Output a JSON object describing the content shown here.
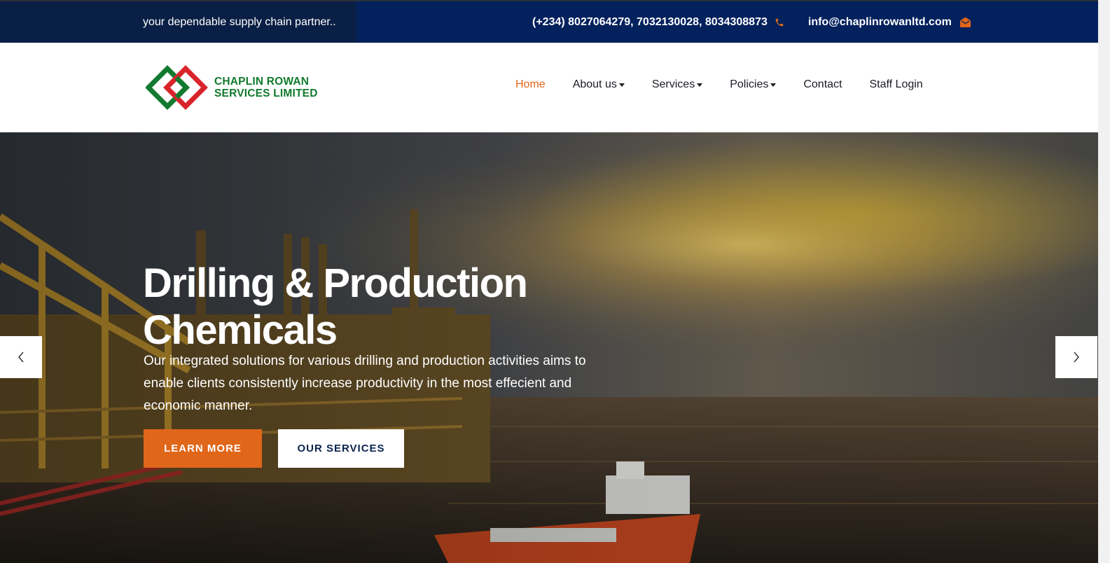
{
  "topbar": {
    "tagline": "your dependable supply chain partner..",
    "phone": "(+234) 8027064279, 7032130028, 8034308873",
    "phone_icon": "phone-icon",
    "email": "info@chaplinrowanltd.com",
    "email_icon": "envelope-icon"
  },
  "logo": {
    "line1": "CHAPLIN ROWAN",
    "line2": "SERVICES LIMITED",
    "mark_icon": "interlocking-diamonds-logo"
  },
  "nav": {
    "items": [
      {
        "label": "Home",
        "active": true
      },
      {
        "label": "About us",
        "dropdown": true
      },
      {
        "label": "Services",
        "dropdown": true
      },
      {
        "label": "Policies",
        "dropdown": true
      },
      {
        "label": "Contact"
      },
      {
        "label": "Staff Login"
      }
    ]
  },
  "hero": {
    "title_line1": "Drilling & Production",
    "title_line2": "Chemicals",
    "text": "Our integrated solutions for various drilling and production activities aims to enable clients consistently increase productivity in the most effecient and economic manner.",
    "primary_button": "LEARN MORE",
    "secondary_button": "OUR SERVICES",
    "prev_icon": "chevron-left-icon",
    "next_icon": "chevron-right-icon"
  },
  "colors": {
    "accent": "#e0661a",
    "topbar": "#03215d",
    "topbar_left": "#0a1f45",
    "logo_green": "#127a2e",
    "logo_red": "#d8242a"
  }
}
